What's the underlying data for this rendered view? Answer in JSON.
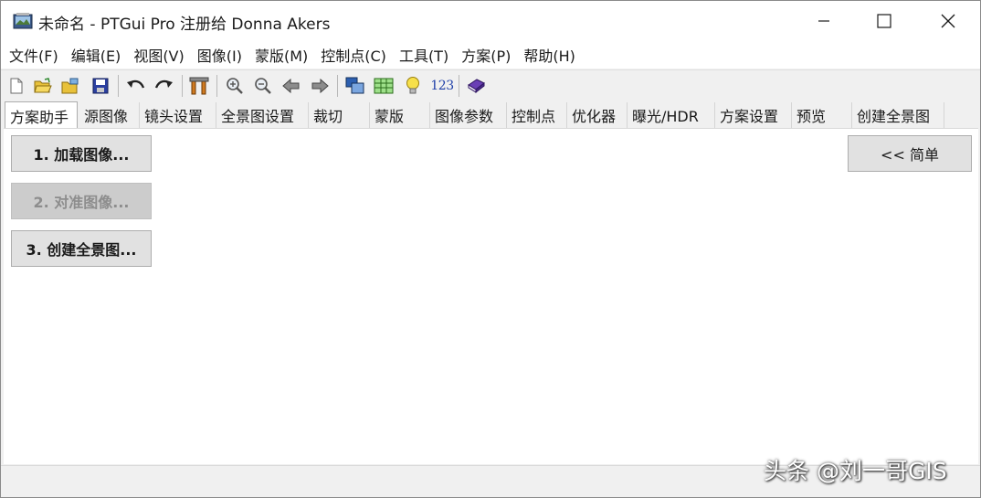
{
  "window": {
    "title": "未命名 - PTGui Pro 注册给 Donna Akers"
  },
  "menu": [
    "文件(F)",
    "编辑(E)",
    "视图(V)",
    "图像(I)",
    "蒙版(M)",
    "控制点(C)",
    "工具(T)",
    "方案(P)",
    "帮助(H)"
  ],
  "toolbar": {
    "number_label": "123"
  },
  "tabs": [
    "方案助手",
    "源图像",
    "镜头设置",
    "全景图设置",
    "裁切",
    "蒙版",
    "图像参数",
    "控制点",
    "优化器",
    "曝光/HDR",
    "方案设置",
    "预览",
    "创建全景图"
  ],
  "active_tab": "方案助手",
  "steps": {
    "load": "1. 加载图像...",
    "align": "2. 对准图像...",
    "create": "3. 创建全景图..."
  },
  "simple_button": "<< 简单",
  "watermark": "头条 @刘一哥GIS",
  "colors": {
    "active_tab_bg": "#ffffff",
    "button_bg": "#e1e1e1",
    "disabled_text": "#8d8d8d",
    "number_blue": "#1f3fa8"
  }
}
